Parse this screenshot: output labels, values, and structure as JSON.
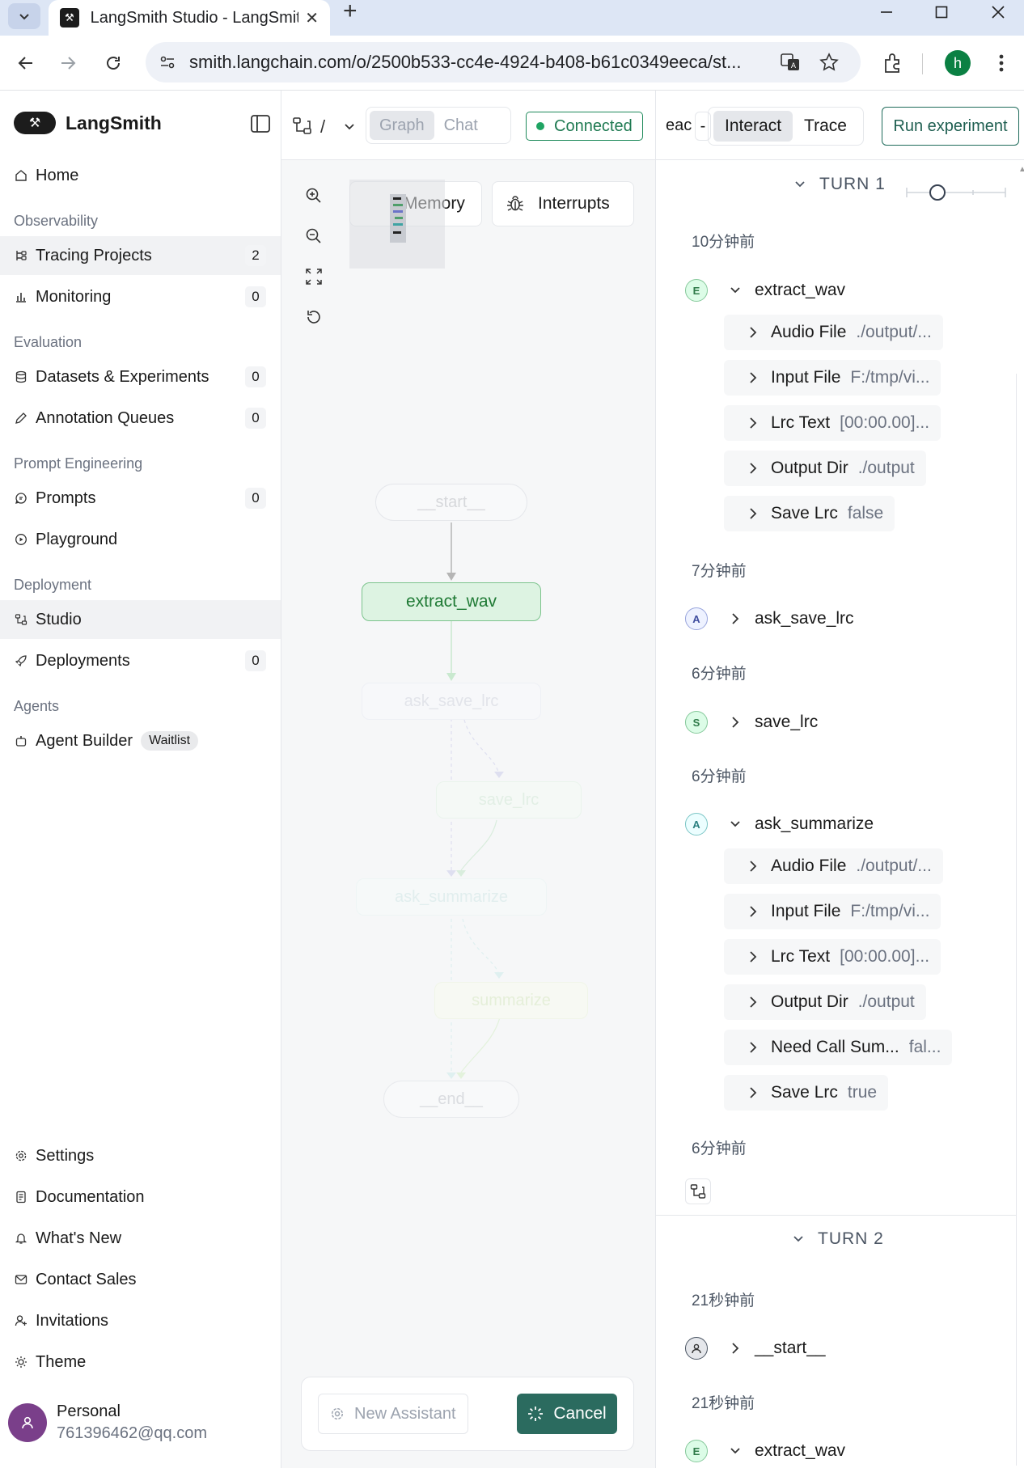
{
  "browser": {
    "tab_title": "LangSmith Studio - LangSmith",
    "url": "smith.langchain.com/o/2500b533-cc4e-4924-b408-b61c0349eeca/st...",
    "profile_initial": "h"
  },
  "sidebar": {
    "brand": "LangSmith",
    "home": "Home",
    "sections": {
      "observability": "Observability",
      "evaluation": "Evaluation",
      "prompt_engineering": "Prompt Engineering",
      "deployment": "Deployment",
      "agents": "Agents"
    },
    "items": {
      "tracing_projects": {
        "label": "Tracing Projects",
        "count": "2"
      },
      "monitoring": {
        "label": "Monitoring",
        "count": "0"
      },
      "datasets": {
        "label": "Datasets & Experiments",
        "count": "0"
      },
      "annotation_queues": {
        "label": "Annotation Queues",
        "count": "0"
      },
      "prompts": {
        "label": "Prompts",
        "count": "0"
      },
      "playground": {
        "label": "Playground"
      },
      "studio": {
        "label": "Studio"
      },
      "deployments": {
        "label": "Deployments",
        "count": "0"
      },
      "agent_builder": {
        "label": "Agent Builder",
        "badge": "Waitlist"
      }
    },
    "bottom": {
      "settings": "Settings",
      "documentation": "Documentation",
      "whats_new": "What's New",
      "contact_sales": "Contact Sales",
      "invitations": "Invitations",
      "theme": "Theme"
    },
    "user": {
      "name": "Personal",
      "email": "761396462@qq.com"
    }
  },
  "graph": {
    "breadcrumb_sep": "/",
    "tabs": {
      "graph": "Graph",
      "chat": "Chat"
    },
    "status": "Connected",
    "memory": "Memory",
    "interrupts": "Interrupts",
    "nodes": {
      "start": "__start__",
      "extract_wav": "extract_wav",
      "ask_save_lrc": "ask_save_lrc",
      "save_lrc": "save_lrc",
      "ask_summarize": "ask_summarize",
      "summarize": "summarize",
      "end": "__end__"
    },
    "new_assistant": "New Assistant",
    "cancel": "Cancel"
  },
  "right": {
    "header": {
      "eac": "eac",
      "dash": "-",
      "interact": "Interact",
      "trace": "Trace",
      "run_experiment": "Run experiment"
    },
    "turn1": {
      "label": "TURN 1",
      "ts1": "10分钟前",
      "run1": {
        "badge": "E",
        "name": "extract_wav"
      },
      "fields1": [
        {
          "key": "Audio File",
          "val": "./output/..."
        },
        {
          "key": "Input File",
          "val": "F:/tmp/vi..."
        },
        {
          "key": "Lrc Text",
          "val": "[00:00.00]..."
        },
        {
          "key": "Output Dir",
          "val": "./output"
        },
        {
          "key": "Save Lrc",
          "val": "false"
        }
      ],
      "ts2": "7分钟前",
      "run2": {
        "badge": "A",
        "name": "ask_save_lrc"
      },
      "ts3": "6分钟前",
      "run3": {
        "badge": "S",
        "name": "save_lrc"
      },
      "ts4": "6分钟前",
      "run4": {
        "badge": "A",
        "name": "ask_summarize"
      },
      "fields4": [
        {
          "key": "Audio File",
          "val": "./output/..."
        },
        {
          "key": "Input File",
          "val": "F:/tmp/vi..."
        },
        {
          "key": "Lrc Text",
          "val": "[00:00.00]..."
        },
        {
          "key": "Output Dir",
          "val": "./output"
        },
        {
          "key": "Need Call Sum...",
          "val": "fal..."
        },
        {
          "key": "Save Lrc",
          "val": "true"
        }
      ],
      "ts5": "6分钟前"
    },
    "turn2": {
      "label": "TURN 2",
      "ts1": "21秒钟前",
      "run1": {
        "name": "__start__"
      },
      "ts2": "21秒钟前",
      "run2": {
        "badge": "E",
        "name": "extract_wav"
      }
    }
  }
}
